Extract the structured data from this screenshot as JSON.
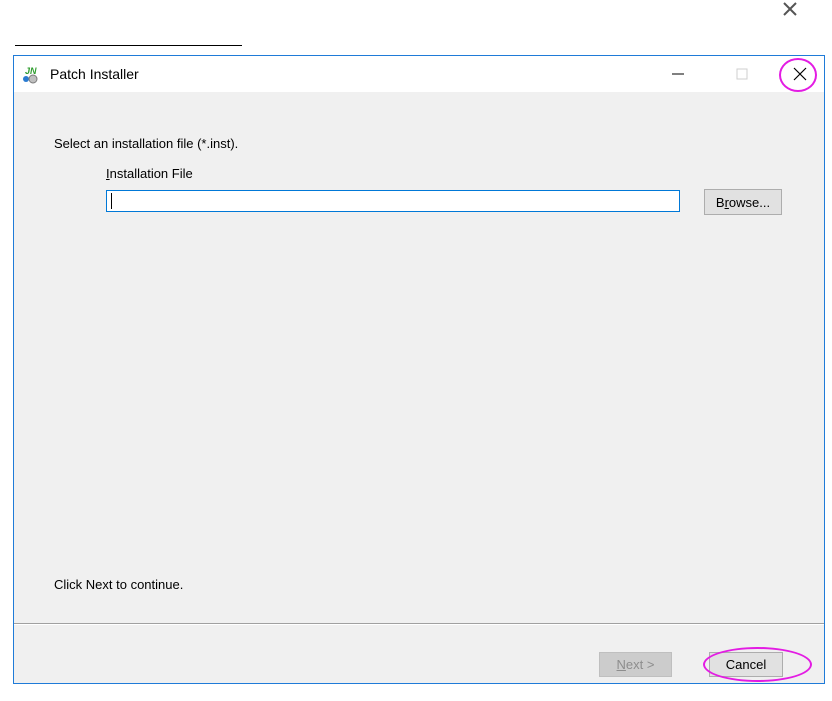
{
  "window": {
    "title": "Patch Installer",
    "minimize_glyph": "—",
    "maximize_glyph": "☐",
    "close_glyph": "✕"
  },
  "dialog": {
    "instruction": "Select an installation file (*.inst).",
    "file_label_mnemonic": "I",
    "file_label_rest": "nstallation File",
    "file_value": "",
    "browse_mnemonic": "r",
    "browse_pre": "B",
    "browse_post": "owse...",
    "status": "Click Next to continue.",
    "next_mnemonic": "N",
    "next_post": "ext >",
    "cancel_label": "Cancel"
  },
  "colors": {
    "accent_border": "#1f7bd8",
    "highlight_ring": "#e31ce3"
  },
  "icons": [
    "close-icon",
    "app-icon",
    "minimize-icon",
    "maximize-icon"
  ]
}
